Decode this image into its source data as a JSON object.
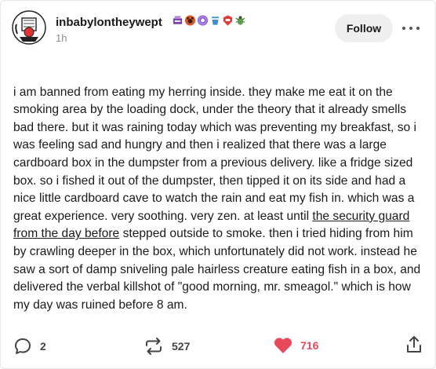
{
  "post": {
    "author": {
      "username": "inbabylontheywept",
      "timestamp": "1h"
    },
    "badges": [
      "typewriter-badge",
      "paw-badge",
      "donut-badge",
      "cup-badge",
      "shield-badge",
      "bug-badge"
    ],
    "follow_label": "Follow",
    "body": {
      "before_link": "i am banned from eating my herring inside. they make me eat it on the smoking area by the loading dock, under the theory that it already smells bad there. but it was raining today which was preventing my breakfast, so i was feeling sad and hungry and then i realized that there was a large cardboard box in the dumpster from a previous delivery. like a fridge sized box. so i fished it out of the dumpster, then tipped it on its side and had a nice little cardboard cave to watch the rain and eat my fish in. which was a great experience. very soothing. very zen. at least until ",
      "link_text": "the security guard from the day before",
      "after_link": " stepped outside to smoke. then i tried hiding from him by crawling deeper in the box, which unfortunately did not work. instead he saw a sort of damp sniveling pale hairless creature eating fish in a box, and delivered the verbal killshot of \"good morning, mr. smeagol.\" which is how my day was ruined before 8 am."
    },
    "footer": {
      "replies": "2",
      "reblogs": "527",
      "likes": "716",
      "like_color": "#e8495a"
    }
  }
}
